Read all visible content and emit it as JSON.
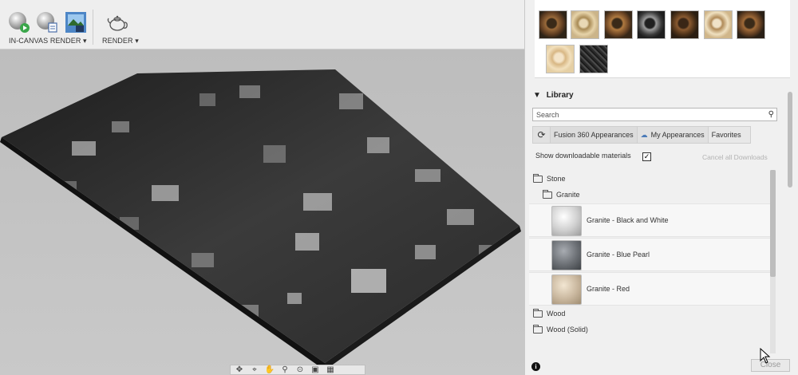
{
  "toolbar": {
    "in_canvas_render_label": "IN-CANVAS RENDER ▾",
    "render_label": "RENDER ▾",
    "icons": [
      "in-canvas-render-start-icon",
      "in-canvas-render-settings-icon",
      "capture-image-icon",
      "render-teapot-icon"
    ]
  },
  "panel": {
    "library_title": "Library",
    "search_placeholder": "Search",
    "tabs": [
      "Fusion 360 Appearances",
      "My Appearances",
      "Favorites"
    ],
    "show_downloadable_label": "Show downloadable materials",
    "show_downloadable_checked": true,
    "cancel_downloads_label": "Cancel all Downloads",
    "tree": {
      "stone_folder": "Stone",
      "granite_folder": "Granite",
      "materials": [
        {
          "name": "Granite - Black and White",
          "color": "#d8d8d8"
        },
        {
          "name": "Granite - Blue Pearl",
          "color": "#6b6f74"
        },
        {
          "name": "Granite - Red",
          "color": "#c9b79e"
        }
      ],
      "wood_folder": "Wood",
      "wood_solid_folder": "Wood (Solid)"
    },
    "close_label": "Close"
  },
  "colors": {
    "panel_bg": "#f0f0f0",
    "toolbar_bg": "#eeeeee",
    "canvas_bg": "#c3c3c3"
  }
}
